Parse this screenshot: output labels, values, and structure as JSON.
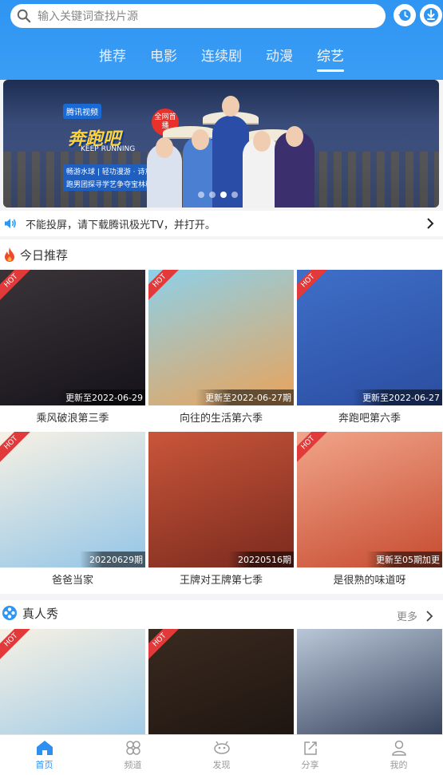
{
  "search": {
    "placeholder": "输入关键词查找片源",
    "icon": "search-icon"
  },
  "header_buttons": [
    {
      "icon": "history-icon"
    },
    {
      "icon": "download-icon"
    }
  ],
  "tabs": [
    {
      "label": "推荐",
      "active": false
    },
    {
      "label": "电影",
      "active": false
    },
    {
      "label": "连续剧",
      "active": false
    },
    {
      "label": "动漫",
      "active": false
    },
    {
      "label": "综艺",
      "active": true
    }
  ],
  "banner": {
    "brand": "腾讯视频",
    "show_title": "奔跑吧",
    "show_subtitle": "KEEP RUNNING",
    "badge": "全网首播",
    "tagline_1": "畅游水球 | 轻功漫游 · 诗意卧底",
    "tagline_2": "跑男团探寻学艺争夺宝林秘籍",
    "dots": 4,
    "active_dot": 3
  },
  "notice": {
    "text": "不能投屏，请下载腾讯极光TV，并打开。"
  },
  "today": {
    "title": "今日推荐",
    "items": [
      {
        "title": "乘风破浪第三季",
        "update": "更新至2022-06-29",
        "hot": "HOT",
        "bg1": "#3a3438",
        "bg2": "#15121a"
      },
      {
        "title": "向往的生活第六季",
        "update": "更新至2022-06-27期",
        "hot": "HOT",
        "bg1": "#8ed0e8",
        "bg2": "#e9a35a"
      },
      {
        "title": "奔跑吧第六季",
        "update": "更新至2022-06-27",
        "hot": "HOT",
        "bg1": "#3f6fc8",
        "bg2": "#2a4da0"
      },
      {
        "title": "爸爸当家",
        "update": "20220629期",
        "hot": "HOT",
        "bg1": "#f7f1e4",
        "bg2": "#93c5e6"
      },
      {
        "title": "王牌对王牌第七季",
        "update": "20220516期",
        "hot": "",
        "bg1": "#c9563a",
        "bg2": "#7a2a1e"
      },
      {
        "title": "是很熟的味道呀",
        "update": "更新至05期加更",
        "hot": "HOT",
        "bg1": "#f1a58a",
        "bg2": "#c64b30"
      }
    ]
  },
  "reality": {
    "title": "真人秀",
    "more": "更多",
    "items": [
      {
        "title": "",
        "update": "",
        "hot": "HOT",
        "bg1": "#f7f1e4",
        "bg2": "#93c5e6"
      },
      {
        "title": "",
        "update": "",
        "hot": "HOT",
        "bg1": "#3a2a20",
        "bg2": "#1a120e"
      },
      {
        "title": "",
        "update": "",
        "hot": "",
        "bg1": "#b9c7d8",
        "bg2": "#1e2a45"
      }
    ]
  },
  "tabbar": [
    {
      "label": "首页",
      "icon": "home-icon",
      "active": true
    },
    {
      "label": "频道",
      "icon": "channel-icon",
      "active": false
    },
    {
      "label": "发现",
      "icon": "discover-icon",
      "active": false
    },
    {
      "label": "分享",
      "icon": "share-icon",
      "active": false
    },
    {
      "label": "我的",
      "icon": "profile-icon",
      "active": false
    }
  ],
  "colors": {
    "accent": "#2f95f2",
    "hot": "#e23a3a",
    "fire": "#ef4b2a"
  }
}
